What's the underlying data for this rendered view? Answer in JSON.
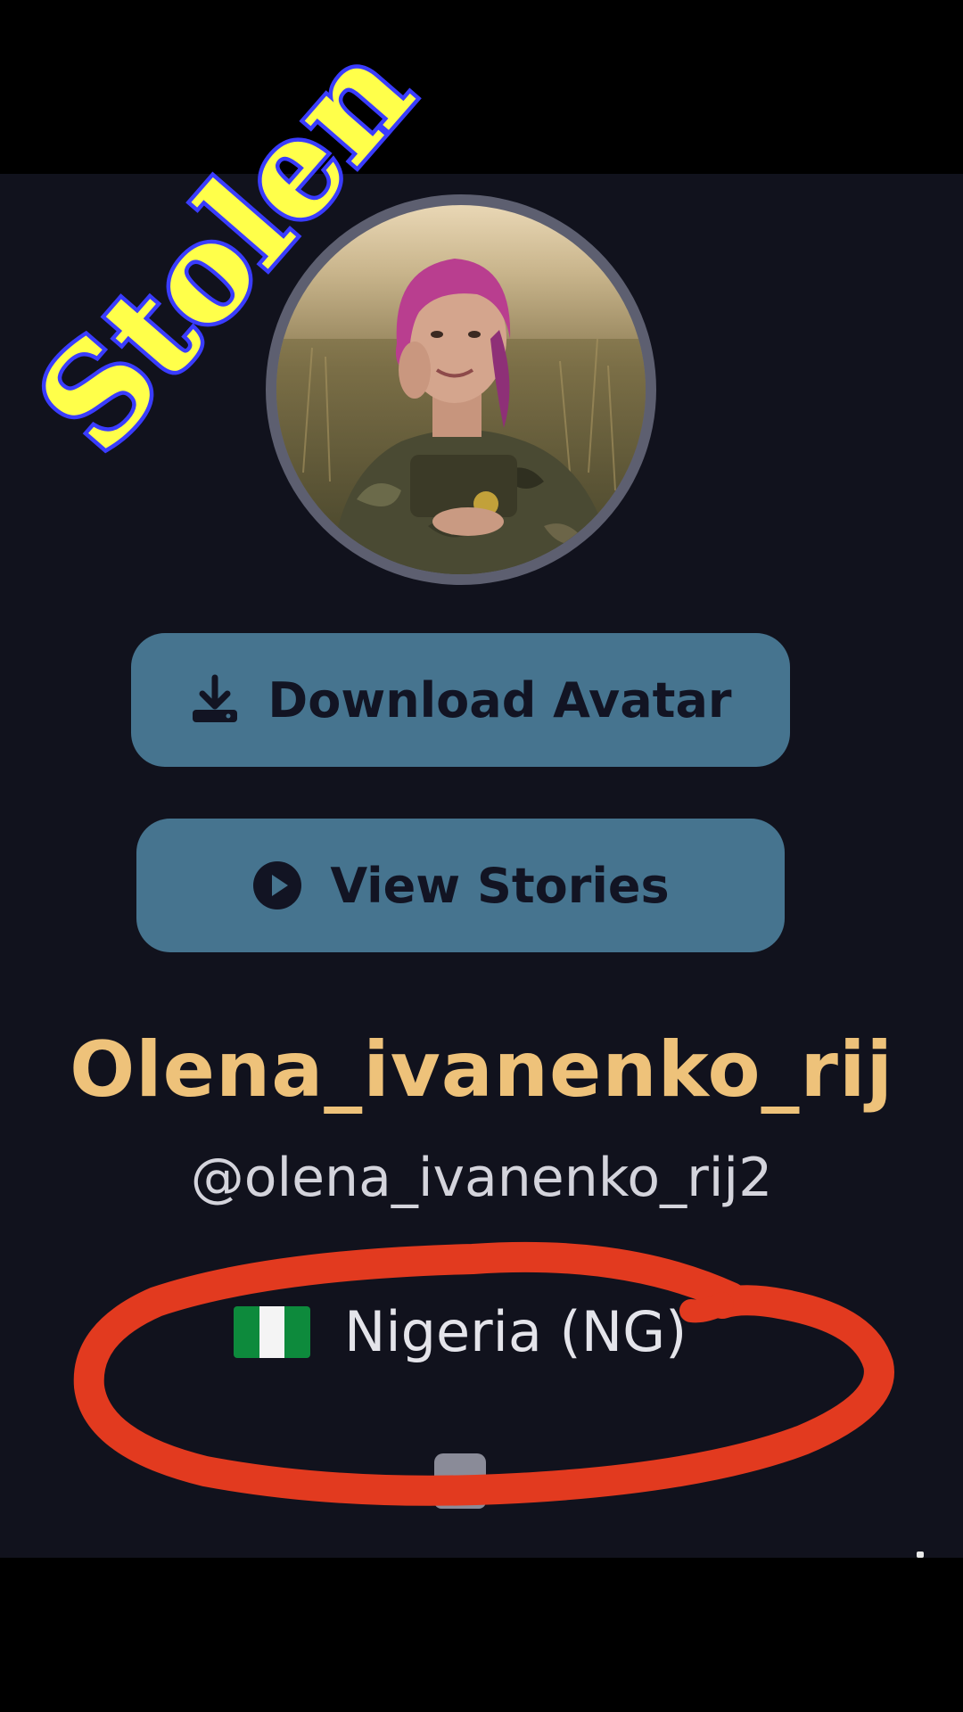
{
  "profile": {
    "display_name": "Olena_ivanenko_rij",
    "username": "@olena_ivanenko_rij2",
    "country_label": "Nigeria (NG)",
    "country_flag": "nigeria-flag"
  },
  "actions": {
    "download_label": "Download Avatar",
    "download_icon": "download-icon",
    "stories_label": "View Stories",
    "stories_icon": "play-circle-icon"
  },
  "overlay": {
    "watermark_text": "Stolen",
    "watermark_color": "#ffff4a",
    "watermark_outline_color": "#3a3cff",
    "annotation_color": "#e23a1f"
  },
  "theme": {
    "panel_background": "#11121d",
    "button_color": "#46748f",
    "name_color": "#eec27a"
  }
}
